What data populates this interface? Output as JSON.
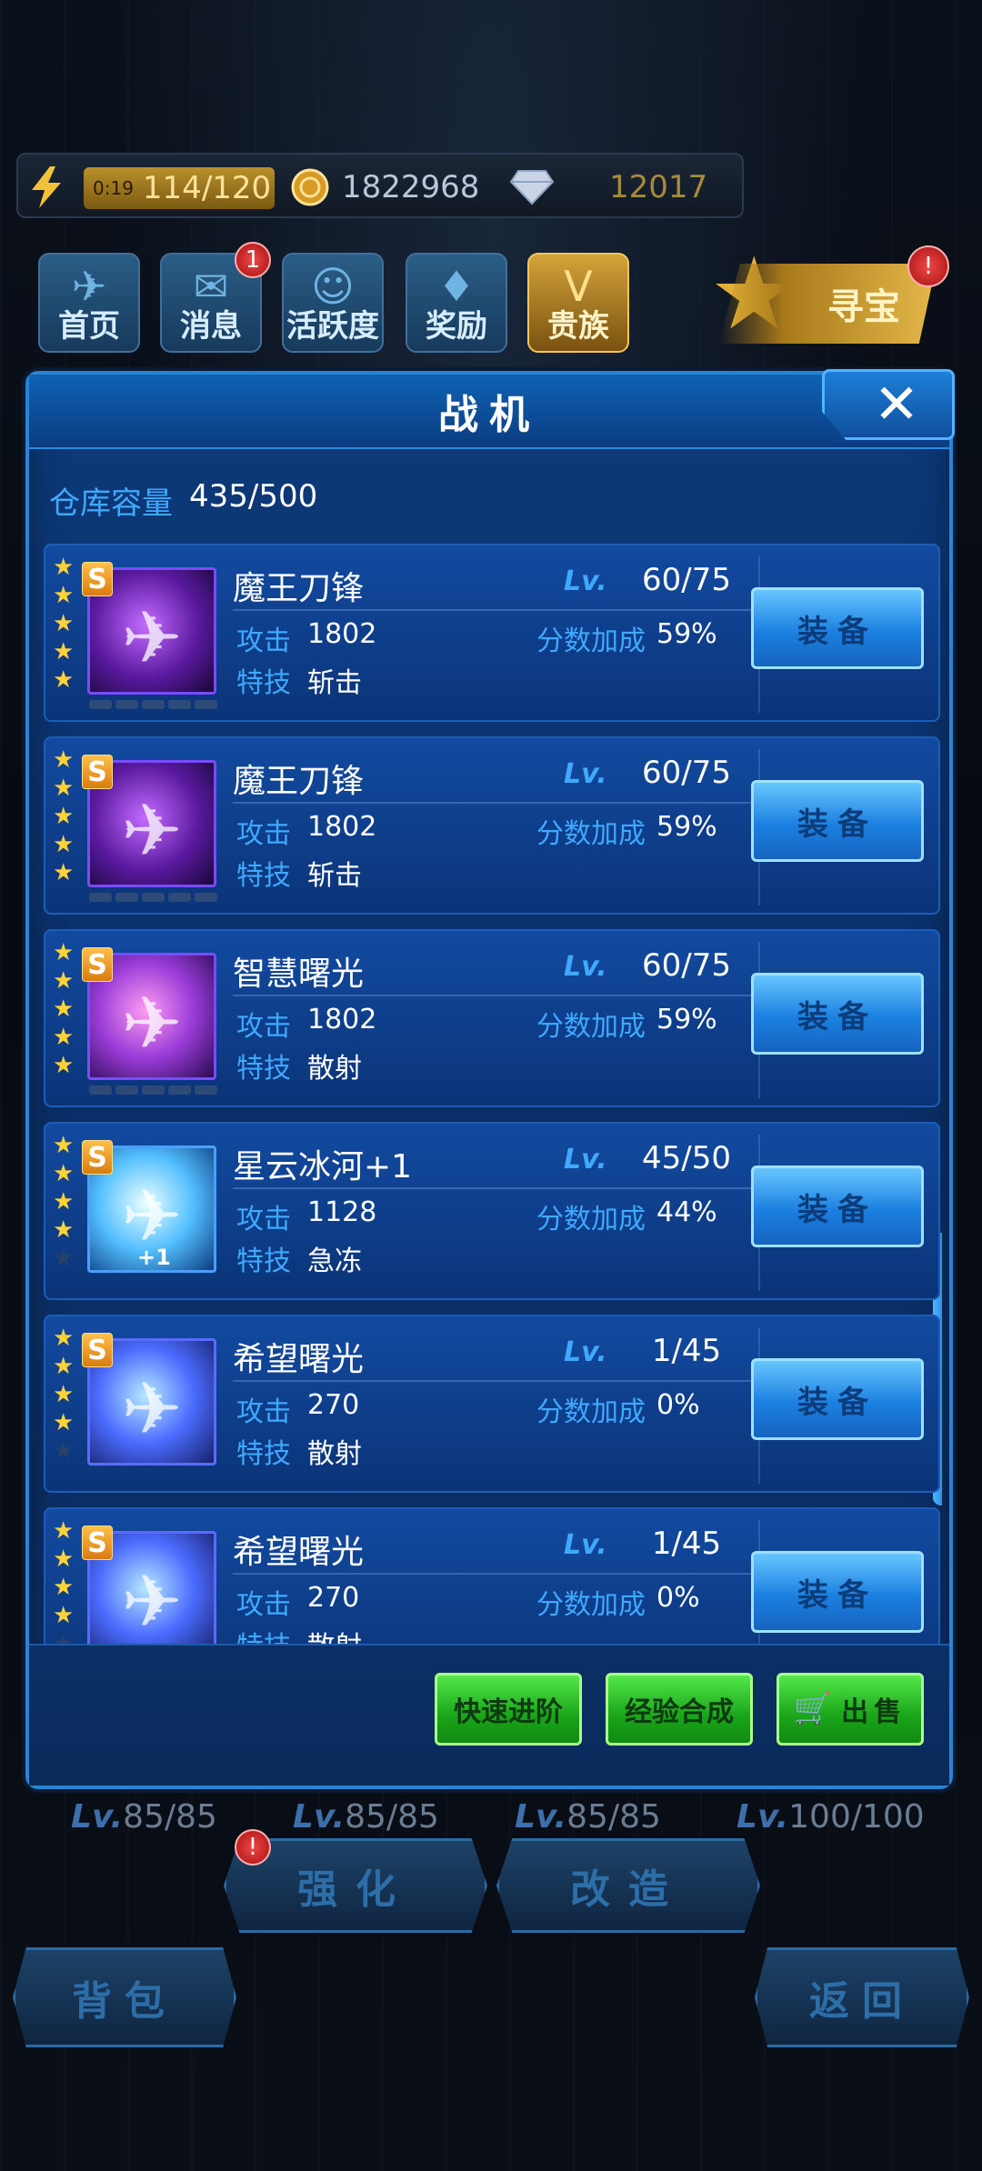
{
  "resources": {
    "energy_timer": "0:19",
    "energy": "114/120",
    "coins": "1822968",
    "diamonds": "12017"
  },
  "nav": [
    {
      "label": "首页",
      "icon": "home-icon"
    },
    {
      "label": "消息",
      "icon": "mail-icon",
      "badge": "1"
    },
    {
      "label": "活跃度",
      "icon": "smile-icon"
    },
    {
      "label": "奖励",
      "icon": "reward-icon"
    },
    {
      "label": "贵族",
      "icon": "noble-icon"
    }
  ],
  "treasure": {
    "label": "寻宝",
    "badge": "!"
  },
  "panel": {
    "title": "战机",
    "capacity_label": "仓库容量",
    "capacity_value": "435/500",
    "level_prefix": "Lv.",
    "attack_label": "攻击",
    "skill_label": "特技",
    "bonus_label": "分数加成",
    "equip_label": "装备",
    "items": [
      {
        "name": "魔王刀锋",
        "stars": 5,
        "grade": "S",
        "level": "60/75",
        "attack": "1802",
        "bonus": "59%",
        "skill": "斩击",
        "thumb": "purple"
      },
      {
        "name": "魔王刀锋",
        "stars": 5,
        "grade": "S",
        "level": "60/75",
        "attack": "1802",
        "bonus": "59%",
        "skill": "斩击",
        "thumb": "purple"
      },
      {
        "name": "智慧曙光",
        "stars": 5,
        "grade": "S",
        "level": "60/75",
        "attack": "1802",
        "bonus": "59%",
        "skill": "散射",
        "thumb": "violet"
      },
      {
        "name": "星云冰河+1",
        "stars": 4,
        "grade": "S",
        "level": "45/50",
        "attack": "1128",
        "bonus": "44%",
        "skill": "急冻",
        "thumb": "ice",
        "plus": "+1"
      },
      {
        "name": "希望曙光",
        "stars": 4,
        "grade": "S",
        "level": "1/45",
        "attack": "270",
        "bonus": "0%",
        "skill": "散射",
        "thumb": "blue"
      },
      {
        "name": "希望曙光",
        "stars": 4,
        "grade": "S",
        "level": "1/45",
        "attack": "270",
        "bonus": "0%",
        "skill": "散射",
        "thumb": "blue"
      }
    ],
    "actions": {
      "quick_advance": "快速进阶",
      "exp_merge": "经验合成",
      "sell": "出售"
    }
  },
  "bottom": {
    "lv_prefix": "Lv.",
    "levels": [
      "85/85",
      "85/85",
      "85/85",
      "100/100"
    ],
    "strengthen": "强化",
    "modify": "改造",
    "strengthen_badge": "!",
    "bag": "背包",
    "back": "返回"
  }
}
